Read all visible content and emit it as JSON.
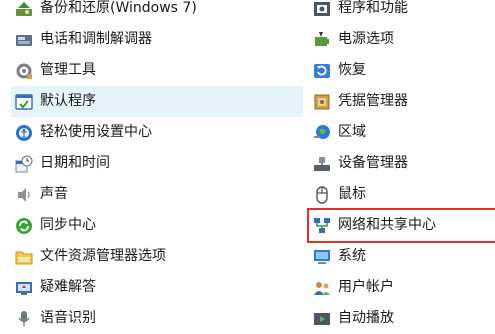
{
  "left_items": [
    {
      "label": "备份和还原(Windows 7)",
      "icon": "backup-restore-icon"
    },
    {
      "label": "电话和调制解调器",
      "icon": "phone-modem-icon"
    },
    {
      "label": "管理工具",
      "icon": "admin-tools-icon"
    },
    {
      "label": "默认程序",
      "icon": "default-programs-icon"
    },
    {
      "label": "轻松使用设置中心",
      "icon": "ease-of-access-icon"
    },
    {
      "label": "日期和时间",
      "icon": "date-time-icon"
    },
    {
      "label": "声音",
      "icon": "sound-icon"
    },
    {
      "label": "同步中心",
      "icon": "sync-center-icon"
    },
    {
      "label": "文件资源管理器选项",
      "icon": "folder-options-icon"
    },
    {
      "label": "疑难解答",
      "icon": "troubleshooting-icon"
    },
    {
      "label": "语音识别",
      "icon": "speech-recognition-icon"
    }
  ],
  "right_items": [
    {
      "label": "程序和功能",
      "icon": "programs-features-icon"
    },
    {
      "label": "电源选项",
      "icon": "power-options-icon"
    },
    {
      "label": "恢复",
      "icon": "recovery-icon"
    },
    {
      "label": "凭据管理器",
      "icon": "credential-manager-icon"
    },
    {
      "label": "区域",
      "icon": "region-icon"
    },
    {
      "label": "设备管理器",
      "icon": "device-manager-icon"
    },
    {
      "label": "鼠标",
      "icon": "mouse-icon"
    },
    {
      "label": "网络和共享中心",
      "icon": "network-sharing-icon"
    },
    {
      "label": "系统",
      "icon": "system-icon"
    },
    {
      "label": "用户帐户",
      "icon": "user-accounts-icon"
    },
    {
      "label": "自动播放",
      "icon": "autoplay-icon"
    }
  ],
  "selected_item": "默认程序",
  "highlighted_item": "网络和共享中心",
  "colors": {
    "selection": "#e5f3fb",
    "highlight_box": "#e0312f"
  }
}
